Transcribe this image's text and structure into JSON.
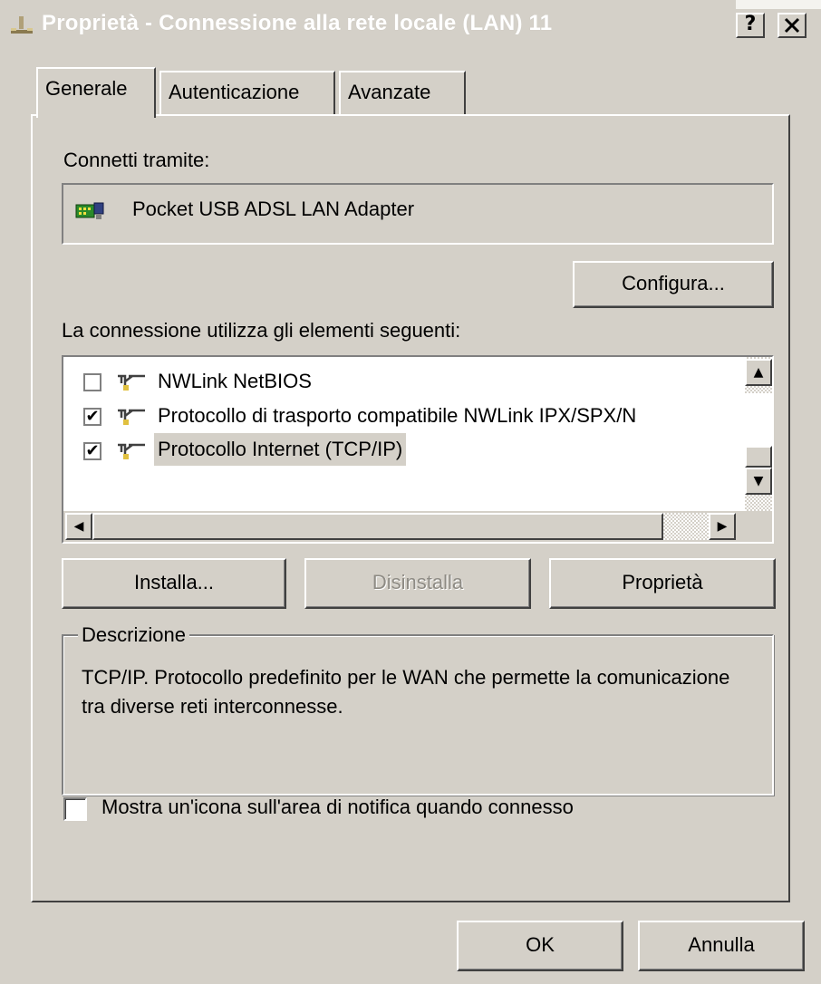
{
  "window": {
    "title": "Proprietà - Connessione alla rete locale (LAN) 11",
    "help_label": "?",
    "close_label": "✕"
  },
  "tabs": [
    {
      "label": "Generale",
      "active": true
    },
    {
      "label": "Autenticazione",
      "active": false
    },
    {
      "label": "Avanzate",
      "active": false
    }
  ],
  "connect_via": {
    "label": "Connetti tramite:",
    "adapter_name": "Pocket USB ADSL LAN Adapter",
    "configure_button": "Configura..."
  },
  "components": {
    "label": "La connessione utilizza gli elementi seguenti:",
    "items": [
      {
        "label": "NWLink NetBIOS",
        "checked": false
      },
      {
        "label": "Protocollo di trasporto compatibile NWLink IPX/SPX/N",
        "checked": true
      },
      {
        "label": "Protocollo Internet (TCP/IP)",
        "checked": true,
        "selected": true
      }
    ]
  },
  "actions": {
    "install": "Installa...",
    "uninstall": "Disinstalla",
    "properties": "Proprietà"
  },
  "description": {
    "legend": "Descrizione",
    "text": "TCP/IP. Protocollo predefinito per le WAN che permette la comunicazione tra diverse reti interconnesse."
  },
  "notify_option": {
    "label": "Mostra un'icona sull'area di notifica quando connesso",
    "checked": false
  },
  "footer": {
    "ok": "OK",
    "cancel": "Annulla"
  },
  "colors": {
    "dialog_bg": "#d4d0c8",
    "list_bg": "#ffffff",
    "selection_bg": "#d4d0c8"
  }
}
